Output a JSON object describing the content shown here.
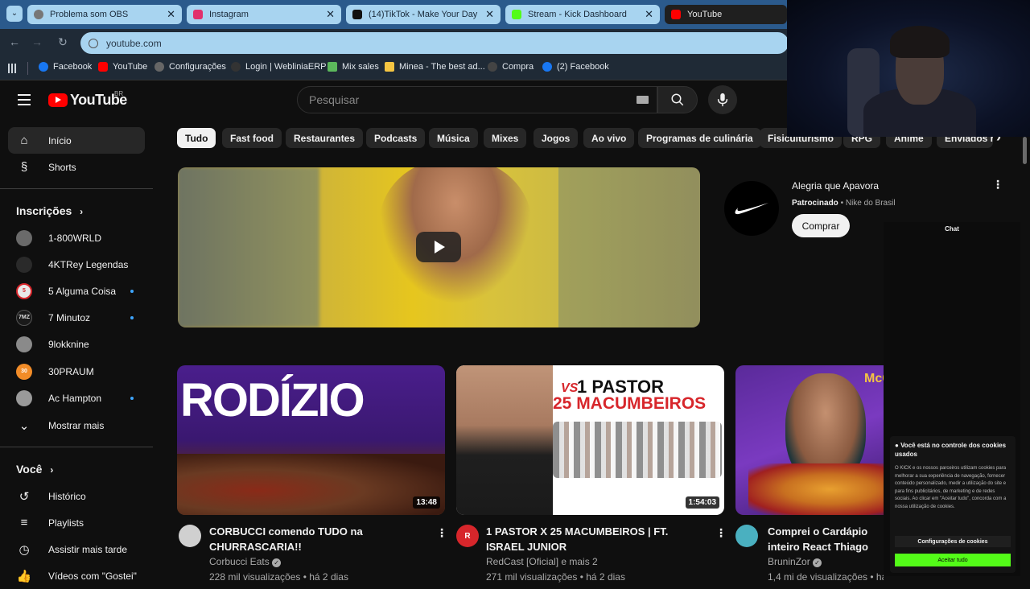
{
  "browser": {
    "tabs": [
      {
        "label": "Problema som OBS",
        "color": "#777777"
      },
      {
        "label": "Instagram",
        "color": "#e1306c"
      },
      {
        "label": "(14)TikTok - Make Your Day",
        "color": "#111111"
      },
      {
        "label": "Stream - Kick Dashboard",
        "color": "#53fc18"
      },
      {
        "label": "YouTube",
        "color": "#ff0000"
      }
    ],
    "url": "youtube.com",
    "bookmarks": [
      {
        "label": "Facebook",
        "color": "#1877f2"
      },
      {
        "label": "YouTube",
        "color": "#ff0000"
      },
      {
        "label": "Configurações",
        "color": "#666666"
      },
      {
        "label": "Login | WebliniaERP",
        "color": "#333333"
      },
      {
        "label": "Mix sales",
        "color": "#5cb85c"
      },
      {
        "label": "Minea - The best ad...",
        "color": "#f5c542"
      },
      {
        "label": "Compra",
        "color": "#444444"
      },
      {
        "label": "(2) Facebook",
        "color": "#1877f2"
      }
    ]
  },
  "youtube": {
    "logo_text": "YouTube",
    "country_code": "BR",
    "search_placeholder": "Pesquisar",
    "sidebar": {
      "main": [
        {
          "label": "Início",
          "icon": "home-icon"
        },
        {
          "label": "Shorts",
          "icon": "shorts-icon"
        }
      ],
      "subscriptions_title": "Inscrições",
      "subscriptions": [
        {
          "label": "1-800WRLD",
          "color": "#6a6a6a",
          "initials": "",
          "new": false
        },
        {
          "label": "4KTRey Legendas",
          "color": "#2a2a2a",
          "initials": "",
          "new": false
        },
        {
          "label": "5 Alguma Coisa",
          "color": "#e8e8e8",
          "initials": "5",
          "new": true
        },
        {
          "label": "7 Minutoz",
          "color": "#1a1a1a",
          "initials": "7MZ",
          "new": true
        },
        {
          "label": "9lokknine",
          "color": "#8a8a8a",
          "initials": "",
          "new": false
        },
        {
          "label": "30PRAUM",
          "color": "#f28c28",
          "initials": "30",
          "new": false
        },
        {
          "label": "Ac Hampton",
          "color": "#9a9a9a",
          "initials": "",
          "new": true
        }
      ],
      "show_more": "Mostrar mais",
      "you_title": "Você",
      "you": [
        {
          "label": "Histórico",
          "icon": "history-icon"
        },
        {
          "label": "Playlists",
          "icon": "playlists-icon"
        },
        {
          "label": "Assistir mais tarde",
          "icon": "watch-later-icon"
        },
        {
          "label": "Vídeos com \"Gostei\"",
          "icon": "liked-icon"
        }
      ]
    },
    "chips": [
      "Tudo",
      "Fast food",
      "Restaurantes",
      "Podcasts",
      "Música",
      "Mixes",
      "Jogos",
      "Ao vivo",
      "Programas de culinária",
      "Fisiculturismo",
      "RPG",
      "Anime",
      "Enviados r"
    ],
    "ad": {
      "title": "Alegria que Apavora",
      "sponsored": "Patrocinado",
      "advertiser": "Nike do Brasil",
      "cta": "Comprar"
    },
    "videos": [
      {
        "title": "CORBUCCI comendo TUDO na CHURRASCARIA!!",
        "channel": "Corbucci Eats",
        "meta": "228 mil visualizações • há 2 dias",
        "duration": "13:48",
        "thumb_text": "RODÍZIO",
        "avatar_color": "#d0d0d0"
      },
      {
        "title": "1 PASTOR X 25 MACUMBEIROS | FT. ISRAEL JUNIOR",
        "channel": "RedCast [Oficial] e mais 2",
        "meta": "271 mil visualizações • há 2 dias",
        "duration": "1:54:03",
        "thumb_text": "1 PASTOR",
        "thumb_text2": "25 MACUMBEIROS",
        "thumb_vs": "VS",
        "avatar_color": "#d7262b",
        "avatar_letter": "R"
      },
      {
        "title": "Comprei o Cardápio inteiro React Thiago Quatroque",
        "channel": "BruninZor",
        "meta": "1,4 mi de visualizações • há",
        "duration": "",
        "thumb_text": "McCa",
        "avatar_color": "#4ab0c0"
      }
    ]
  },
  "overlay": {
    "chat_title": "Chat",
    "cookie_title": "Você está no controle dos cookies usados",
    "cookie_body": "O KICK e os nossos parceiros utilizam cookies para melhorar a sua experiência de navegação, fornecer conteúdo personalizado, medir a utilização do site e para fins publicitários, de marketing e de redes sociais. Ao clicar em \"Aceitar tudo\", concorda com a nossa utilização de cookies.",
    "cookie_settings": "Configurações de cookies",
    "cookie_accept": "Aceitar tudo"
  }
}
